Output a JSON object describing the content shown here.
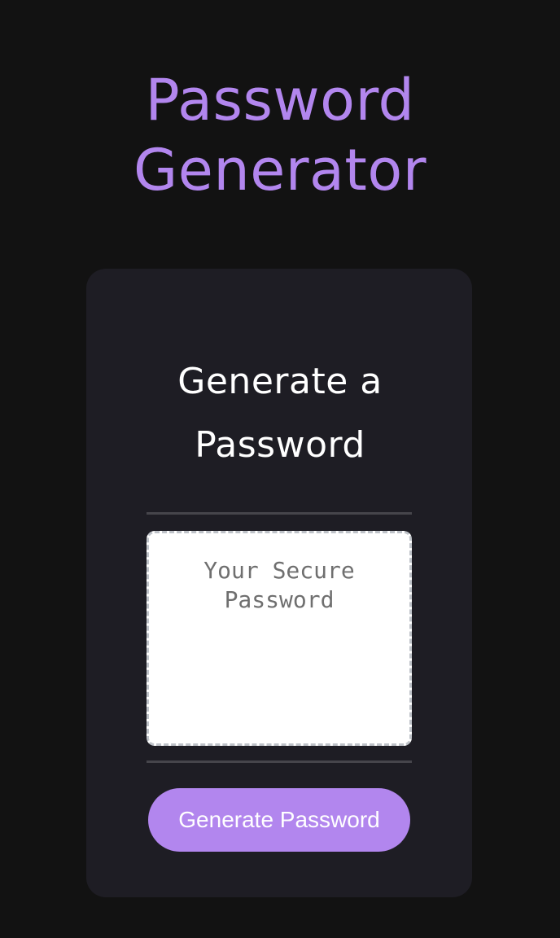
{
  "header": {
    "title_line1": "Password",
    "title_line2": "Generator"
  },
  "card": {
    "heading_line1": "Generate a",
    "heading_line2": "Password",
    "password": {
      "value": "",
      "placeholder": "Your Secure Password"
    },
    "generate_button_label": "Generate Password"
  },
  "colors": {
    "background": "#121212",
    "card": "#1e1d24",
    "accent": "#b286ee",
    "divider": "#46454b"
  }
}
